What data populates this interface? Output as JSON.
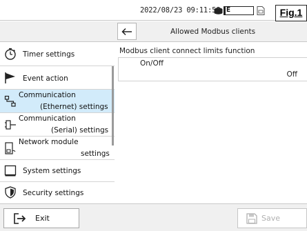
{
  "status": {
    "datetime": "2022/08/23 09:11:58",
    "media_label": "E",
    "disk_icon": "disk-icon",
    "document_icon": "document-icon",
    "figure_label": "Fig.1"
  },
  "header": {
    "back_icon": "arrow-left-icon",
    "title": "Allowed Modbus clients"
  },
  "sidebar": {
    "items": [
      {
        "icon": "stopwatch-icon",
        "line1": "Timer settings",
        "line2": ""
      },
      {
        "icon": "flag-icon",
        "line1": "Event action",
        "line2": ""
      },
      {
        "icon": "network-icon",
        "line1": "Communication",
        "line2": "(Ethernet) settings",
        "active": true
      },
      {
        "icon": "serial-connector-icon",
        "line1": "Communication",
        "line2": "(Serial) settings"
      },
      {
        "icon": "network-module-icon",
        "line1": "Network module",
        "line2": "settings"
      },
      {
        "icon": "monitor-icon",
        "line1": "System settings",
        "line2": ""
      },
      {
        "icon": "shield-icon",
        "line1": "Security settings",
        "line2": ""
      }
    ]
  },
  "content": {
    "section_title": "Modbus client connect limits function",
    "setting": {
      "label": "On/Off",
      "value": "Off"
    }
  },
  "footer": {
    "exit_label": "Exit",
    "save_label": "Save"
  },
  "colors": {
    "active_item_bg": "#d2ebfa",
    "bar_bg": "#f0f0f0",
    "disabled_text": "#b0b0b0"
  }
}
